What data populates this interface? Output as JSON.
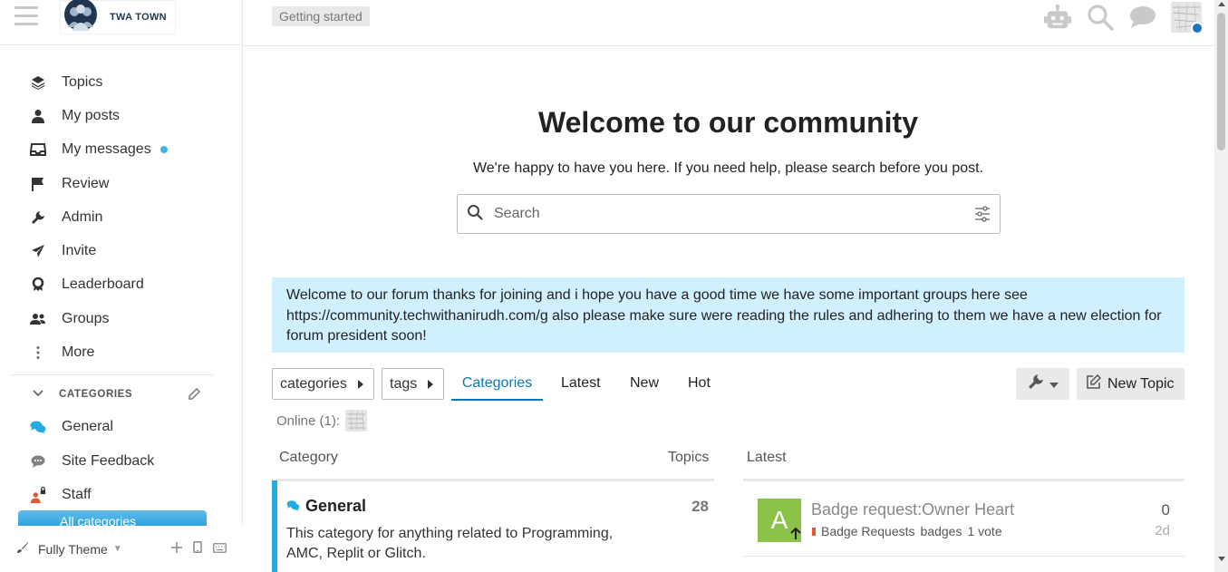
{
  "brand": {
    "name": "TWA TOWN"
  },
  "sidebar": {
    "items": [
      {
        "label": "Topics",
        "icon": "layers-icon"
      },
      {
        "label": "My posts",
        "icon": "user-icon"
      },
      {
        "label": "My messages",
        "icon": "inbox-icon",
        "unread_dot": true
      },
      {
        "label": "Review",
        "icon": "flag-icon"
      },
      {
        "label": "Admin",
        "icon": "wrench-icon"
      },
      {
        "label": "Invite",
        "icon": "paper-plane-icon"
      },
      {
        "label": "Leaderboard",
        "icon": "award-icon"
      },
      {
        "label": "Groups",
        "icon": "users-icon"
      },
      {
        "label": "More",
        "icon": "ellipsis-vertical-icon"
      }
    ],
    "categories_header": "CATEGORIES",
    "categories": [
      {
        "label": "General",
        "icon": "comments-icon",
        "color": "#25aae1"
      },
      {
        "label": "Site Feedback",
        "icon": "comment-icon",
        "color": "#808281"
      },
      {
        "label": "Staff",
        "icon": "staff-lock-icon",
        "color": "#e45735"
      }
    ],
    "all_categories": "All categories",
    "footer": {
      "theme_label": "Fully Theme"
    }
  },
  "header": {
    "getting_started": "Getting started"
  },
  "main": {
    "welcome_title": "Welcome to our community",
    "welcome_subtitle": "We're happy to have you here. If you need help, please search before you post.",
    "search_placeholder": "Search",
    "banner_text": "Welcome to our forum thanks for joining and i hope you have a good time we have some important groups here see https://community.techwithanirudh.com/g also please make sure were reading the rules and adhering to them we have a new election for forum president soon!",
    "filters": {
      "categories_dropdown": "categories",
      "tags_dropdown": "tags"
    },
    "tabs": [
      {
        "label": "Categories",
        "active": true
      },
      {
        "label": "Latest",
        "active": false
      },
      {
        "label": "New",
        "active": false
      },
      {
        "label": "Hot",
        "active": false
      }
    ],
    "new_topic": "New Topic",
    "online": "Online (1):",
    "columns": {
      "category": "Category",
      "topics": "Topics",
      "latest": "Latest"
    },
    "category_rows": [
      {
        "name": "General",
        "topics": "28",
        "description": "This category for anything related to Programming, AMC, Replit or Glitch.",
        "color": "#25aae1"
      }
    ],
    "latest_rows": [
      {
        "avatar_letter": "A",
        "title": "Badge request:Owner Heart",
        "category": "Badge Requests",
        "tag": "badges",
        "votes": "1 vote",
        "posts": "0",
        "age": "2d",
        "avatar_color": "#8bc34a"
      }
    ]
  },
  "colors": {
    "accent": "#0a79b8",
    "banner": "#d1f0ff",
    "general": "#25aae1"
  }
}
